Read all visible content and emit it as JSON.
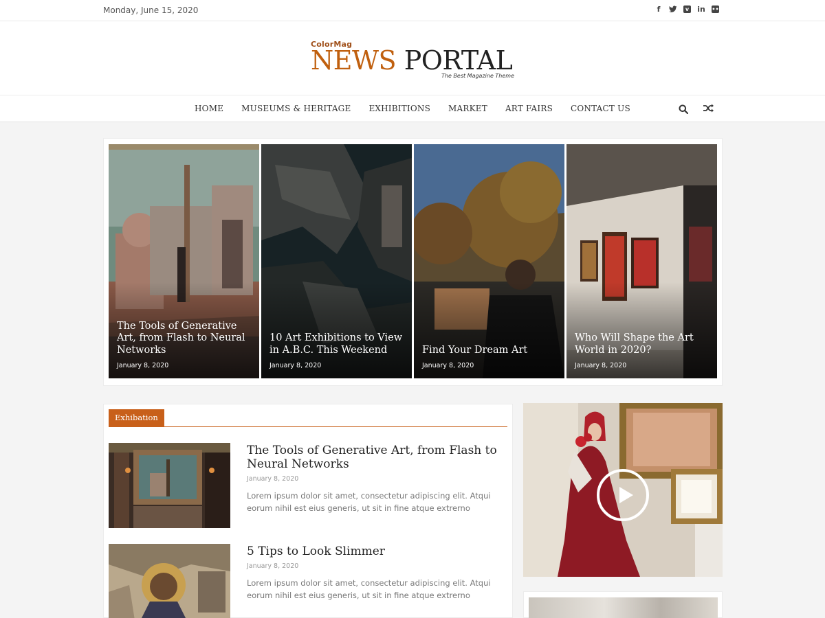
{
  "topbar": {
    "date": "Monday, June 15, 2020",
    "social": [
      {
        "icon": "facebook-icon",
        "glyph": "f"
      },
      {
        "icon": "twitter-icon",
        "glyph": "t"
      },
      {
        "icon": "vimeo-icon",
        "glyph": "v"
      },
      {
        "icon": "linkedin-icon",
        "glyph": "in"
      },
      {
        "icon": "flickr-icon",
        "glyph": "••"
      }
    ]
  },
  "header": {
    "brand_small": "ColorMag",
    "brand_news": "NEWS",
    "brand_portal": "PORTAL",
    "tagline": "The Best Magazine Theme"
  },
  "nav": {
    "items": [
      "HOME",
      "MUSEUMS & HERITAGE",
      "EXHIBITIONS",
      "MARKET",
      "ART FAIRS",
      "CONTACT US"
    ],
    "search_icon": "search-icon",
    "random_icon": "shuffle-icon"
  },
  "featured": [
    {
      "title": "The Tools of Generative Art, from Flash to Neural Networks",
      "date": "January 8, 2020"
    },
    {
      "title": "10 Art Exhibitions to View in A.B.C. This Weekend",
      "date": "January 8, 2020"
    },
    {
      "title": "Find Your Dream Art",
      "date": "January 8, 2020"
    },
    {
      "title": "Who Will Shape the Art World in 2020?",
      "date": "January 8, 2020"
    }
  ],
  "section": {
    "label": "Exhibation",
    "posts": [
      {
        "title": "The Tools of Generative Art, from Flash to Neural Networks",
        "date": "January 8, 2020",
        "excerpt": "Lorem ipsum dolor sit amet, consectetur adipiscing elit. Atqui eorum nihil est eius generis, ut sit in fine atque extrerno"
      },
      {
        "title": "5 Tips to Look Slimmer",
        "date": "January 8, 2020",
        "excerpt": "Lorem ipsum dolor sit amet, consectetur adipiscing elit. Atqui eorum nihil est eius generis, ut sit in fine atque extrerno"
      }
    ]
  },
  "sidebar": {
    "video_icon": "play-icon"
  },
  "colors": {
    "accent": "#c8601a",
    "brand_news": "#c0600f",
    "text_dark": "#222222"
  }
}
